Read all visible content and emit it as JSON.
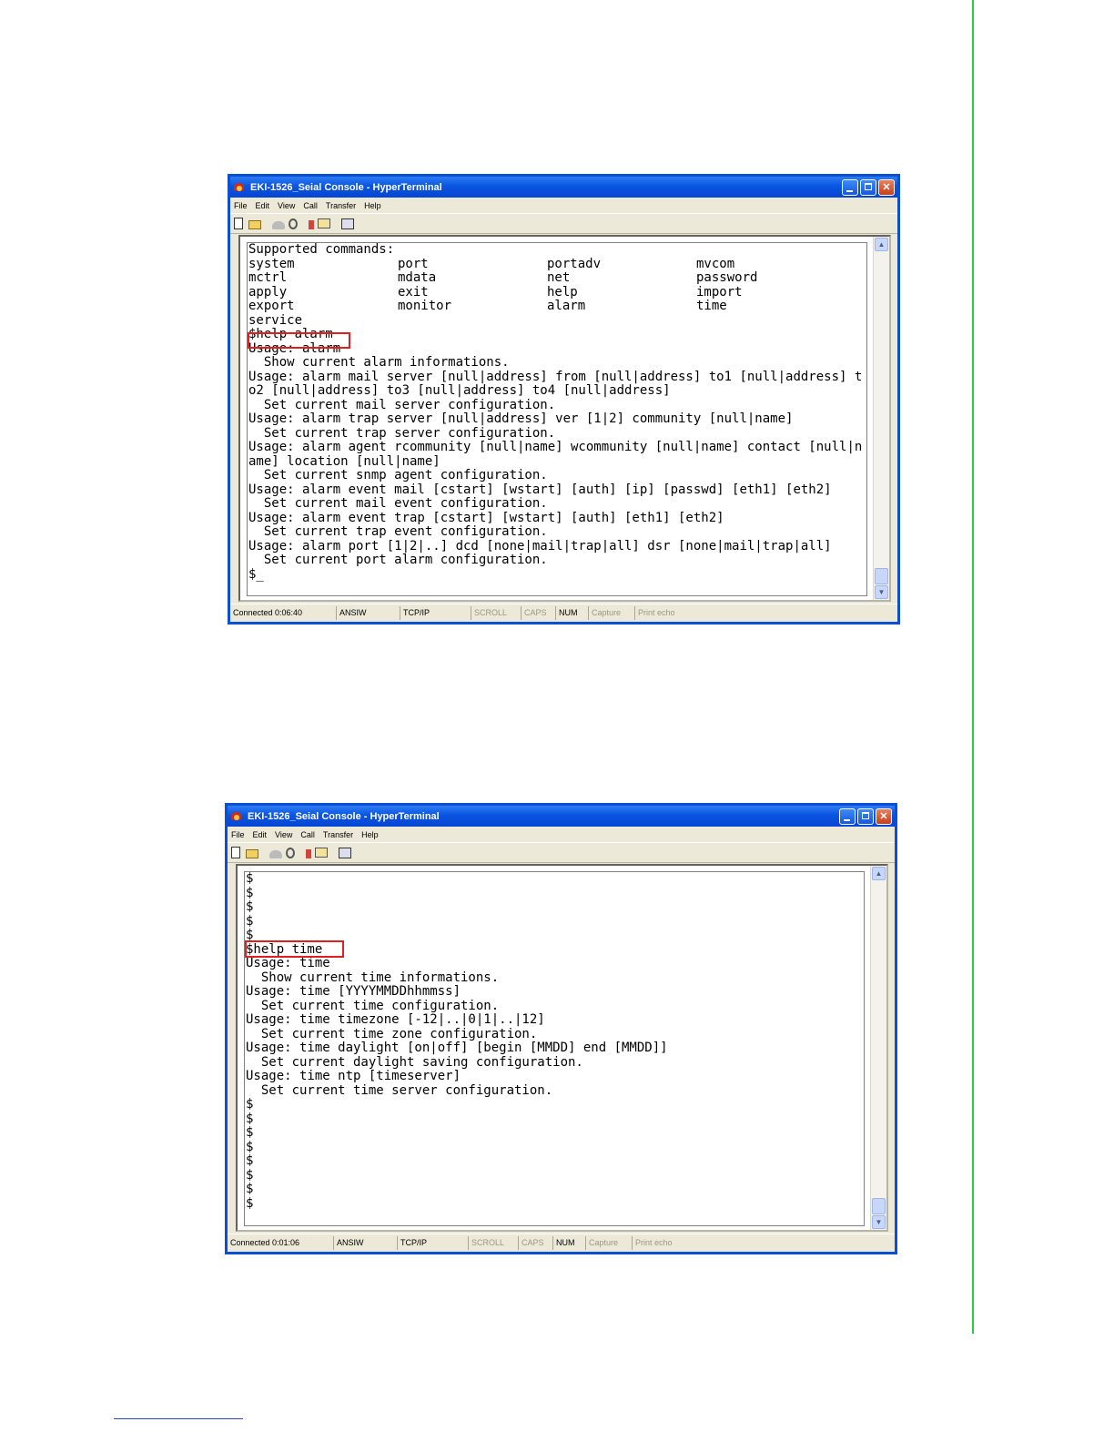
{
  "windows": [
    {
      "title": "EKI-1526_Seial Console - HyperTerminal",
      "menu": [
        "File",
        "Edit",
        "View",
        "Call",
        "Transfer",
        "Help"
      ],
      "commands_header": "Supported commands:",
      "commands": [
        [
          "system",
          "port",
          "portadv",
          "mvcom"
        ],
        [
          "mctrl",
          "mdata",
          "net",
          "password"
        ],
        [
          "apply",
          "exit",
          "help",
          "import"
        ],
        [
          "export",
          "monitor",
          "alarm",
          "time"
        ],
        [
          "service"
        ]
      ],
      "lines": [
        "$help alarm",
        "Usage: alarm",
        "  Show current alarm informations.",
        "Usage: alarm mail server [null|address] from [null|address] to1 [null|address] t",
        "o2 [null|address] to3 [null|address] to4 [null|address]",
        "  Set current mail server configuration.",
        "Usage: alarm trap server [null|address] ver [1|2] community [null|name]",
        "  Set current trap server configuration.",
        "Usage: alarm agent rcommunity [null|name] wcommunity [null|name] contact [null|n",
        "ame] location [null|name]",
        "  Set current snmp agent configuration.",
        "Usage: alarm event mail [cstart] [wstart] [auth] [ip] [passwd] [eth1] [eth2]",
        "  Set current mail event configuration.",
        "Usage: alarm event trap [cstart] [wstart] [auth] [eth1] [eth2]",
        "  Set current trap event configuration.",
        "Usage: alarm port [1|2|..] dcd [none|mail|trap|all] dsr [none|mail|trap|all]",
        "  Set current port alarm configuration.",
        "$_"
      ],
      "status": {
        "connected": "Connected 0:06:40",
        "emulation": "ANSIW",
        "protocol": "TCP/IP",
        "scroll": "SCROLL",
        "caps": "CAPS",
        "num": "NUM",
        "capture": "Capture",
        "print_echo": "Print echo"
      }
    },
    {
      "title": "EKI-1526_Seial Console - HyperTerminal",
      "menu": [
        "File",
        "Edit",
        "View",
        "Call",
        "Transfer",
        "Help"
      ],
      "lines": [
        "$",
        "$",
        "$",
        "$",
        "$",
        "$help time",
        "Usage: time",
        "  Show current time informations.",
        "Usage: time [YYYYMMDDhhmmss]",
        "  Set current time configuration.",
        "Usage: time timezone [-12|..|0|1|..|12]",
        "  Set current time zone configuration.",
        "Usage: time daylight [on|off] [begin [MMDD] end [MMDD]]",
        "  Set current daylight saving configuration.",
        "Usage: time ntp [timeserver]",
        "  Set current time server configuration.",
        "$",
        "$",
        "$",
        "$",
        "$",
        "$",
        "$",
        "$"
      ],
      "status": {
        "connected": "Connected 0:01:06",
        "emulation": "ANSIW",
        "protocol": "TCP/IP",
        "scroll": "SCROLL",
        "caps": "CAPS",
        "num": "NUM",
        "capture": "Capture",
        "print_echo": "Print echo"
      }
    }
  ],
  "colors": {
    "title_bar": "#0a55e0",
    "highlight_box": "#e02020",
    "page_rule": "#22d03a"
  }
}
